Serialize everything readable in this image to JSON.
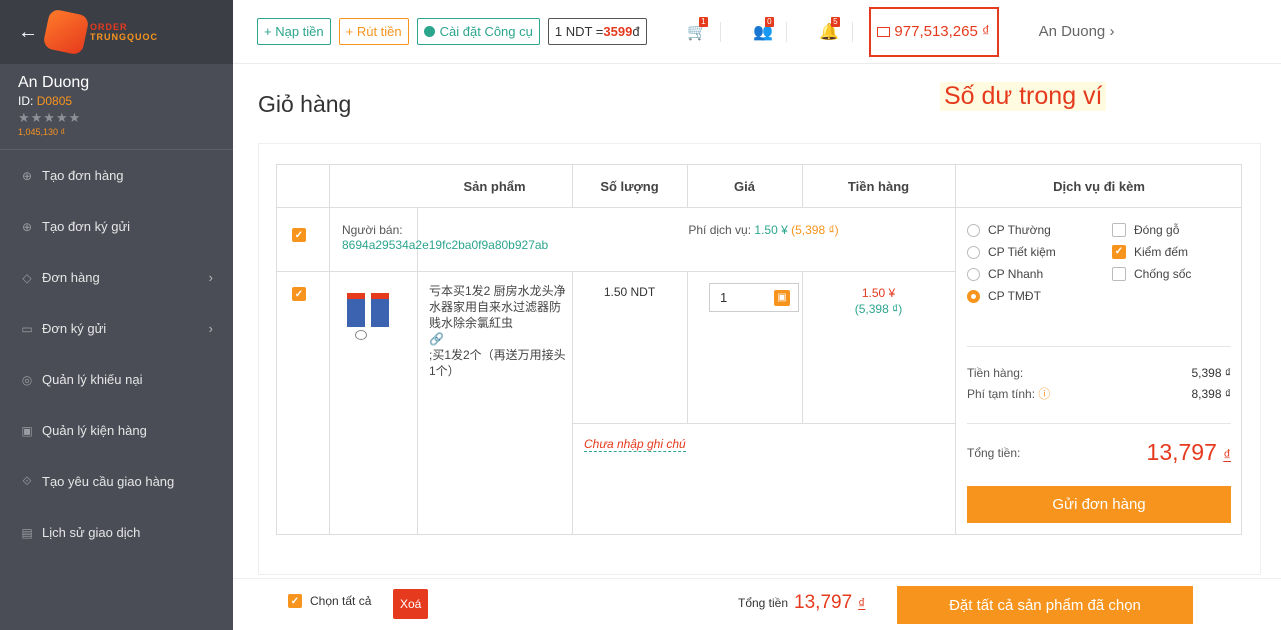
{
  "sidebar": {
    "logo_line1": "ORDER",
    "logo_line2": "TRUNGQUOC",
    "user_name": "An Duong",
    "user_id_label": "ID:",
    "user_id": "D0805",
    "stars": "★★★★★",
    "balance": "1,045,130 ₫",
    "items": [
      {
        "label": "Tạo đơn hàng",
        "icon": "plus-circle-icon",
        "chevron": ""
      },
      {
        "label": "Tạo đơn ký gửi",
        "icon": "plus-circle-icon",
        "chevron": ""
      },
      {
        "label": "Đơn hàng",
        "icon": "tag-icon",
        "chevron": "›"
      },
      {
        "label": "Đơn ký gửi",
        "icon": "truck-icon",
        "chevron": "›"
      },
      {
        "label": "Quản lý khiếu nại",
        "icon": "complaint-icon",
        "chevron": ""
      },
      {
        "label": "Quản lý kiện hàng",
        "icon": "package-icon",
        "chevron": ""
      },
      {
        "label": "Tạo yêu cầu giao hàng",
        "icon": "delivery-icon",
        "chevron": ""
      },
      {
        "label": "Lịch sử giao dịch",
        "icon": "card-icon",
        "chevron": ""
      }
    ]
  },
  "topbar": {
    "deposit": "+ Nạp tiền",
    "withdraw": "+ Rút tiền",
    "install_tool": "Cài đặt Công cụ",
    "rate_prefix": "1 NDT = ",
    "rate_value": "3599",
    "rate_suffix": " đ",
    "cart_badge": "1",
    "users_badge": "0",
    "bell_badge": "5",
    "wallet": "977,513,265 ₫",
    "user": "An Duong ›"
  },
  "page": {
    "title": "Giỏ hàng",
    "annotation": "Số dư trong ví"
  },
  "table": {
    "headers": {
      "product": "Sản phẩm",
      "quantity": "Số lượng",
      "price": "Giá",
      "amount": "Tiền hàng",
      "services": "Dịch vụ đi kèm"
    },
    "seller_label": "Người bán:",
    "seller_id": "8694a29534a2e19fc2ba0f9a80b927ab",
    "service_fee_label": "Phí dịch vụ: ",
    "service_fee_cny": "1.50 ¥",
    "service_fee_vnd": "(5,398 ₫)",
    "product_name": "亏本买1发2 厨房水龙头净水器家用自来水过滤器防贱水除余氯紅虫",
    "product_link_icon": "🔗",
    "product_variant": ";买1发2个（再送万用接头1个）",
    "unit_price": "1.50 NDT",
    "qty": "1",
    "line_cny": "1.50 ¥",
    "line_vnd": "(5,398 ₫)",
    "note_placeholder": "Chưa nhập ghi chú",
    "shipping_options": [
      "CP Thường",
      "CP Tiết kiệm",
      "CP Nhanh",
      "CP TMĐT"
    ],
    "extra_options": [
      "Đóng gỗ",
      "Kiểm đếm",
      "Chống sốc"
    ],
    "goods_label": "Tiền hàng:",
    "goods_value": "5,398 ₫",
    "temp_fee_label": "Phí tạm tính:",
    "temp_fee_value": "8,398 ₫",
    "total_label": "Tổng tiền:",
    "total_value": "13,797",
    "currency": "₫",
    "send_button": "Gửi đơn hàng"
  },
  "footer": {
    "select_all": "Chọn tất cả",
    "delete": "Xoá",
    "total_label": "Tổng tiền",
    "total_value": "13,797",
    "currency": "₫",
    "order_all": "Đặt tất cả sản phẩm đã chọn"
  },
  "colors": {
    "accent": "#f7941d",
    "danger": "#e53a1d",
    "teal": "#2ca58d",
    "sidebar": "#4b4d56"
  }
}
